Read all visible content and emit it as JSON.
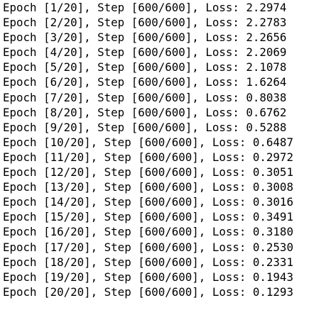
{
  "console": {
    "lines": [
      "Epoch [1/20], Step [600/600], Loss: 2.2974",
      "Epoch [2/20], Step [600/600], Loss: 2.2783",
      "Epoch [3/20], Step [600/600], Loss: 2.2656",
      "Epoch [4/20], Step [600/600], Loss: 2.2069",
      "Epoch [5/20], Step [600/600], Loss: 2.1078",
      "Epoch [6/20], Step [600/600], Loss: 1.6264",
      "Epoch [7/20], Step [600/600], Loss: 0.8038",
      "Epoch [8/20], Step [600/600], Loss: 0.6762",
      "Epoch [9/20], Step [600/600], Loss: 0.5288",
      "Epoch [10/20], Step [600/600], Loss: 0.6487",
      "Epoch [11/20], Step [600/600], Loss: 0.2972",
      "Epoch [12/20], Step [600/600], Loss: 0.3051",
      "Epoch [13/20], Step [600/600], Loss: 0.3008",
      "Epoch [14/20], Step [600/600], Loss: 0.3016",
      "Epoch [15/20], Step [600/600], Loss: 0.3491",
      "Epoch [16/20], Step [600/600], Loss: 0.3180",
      "Epoch [17/20], Step [600/600], Loss: 0.2530",
      "Epoch [18/20], Step [600/600], Loss: 0.2331",
      "Epoch [19/20], Step [600/600], Loss: 0.1943",
      "Epoch [20/20], Step [600/600], Loss: 0.1293"
    ]
  }
}
